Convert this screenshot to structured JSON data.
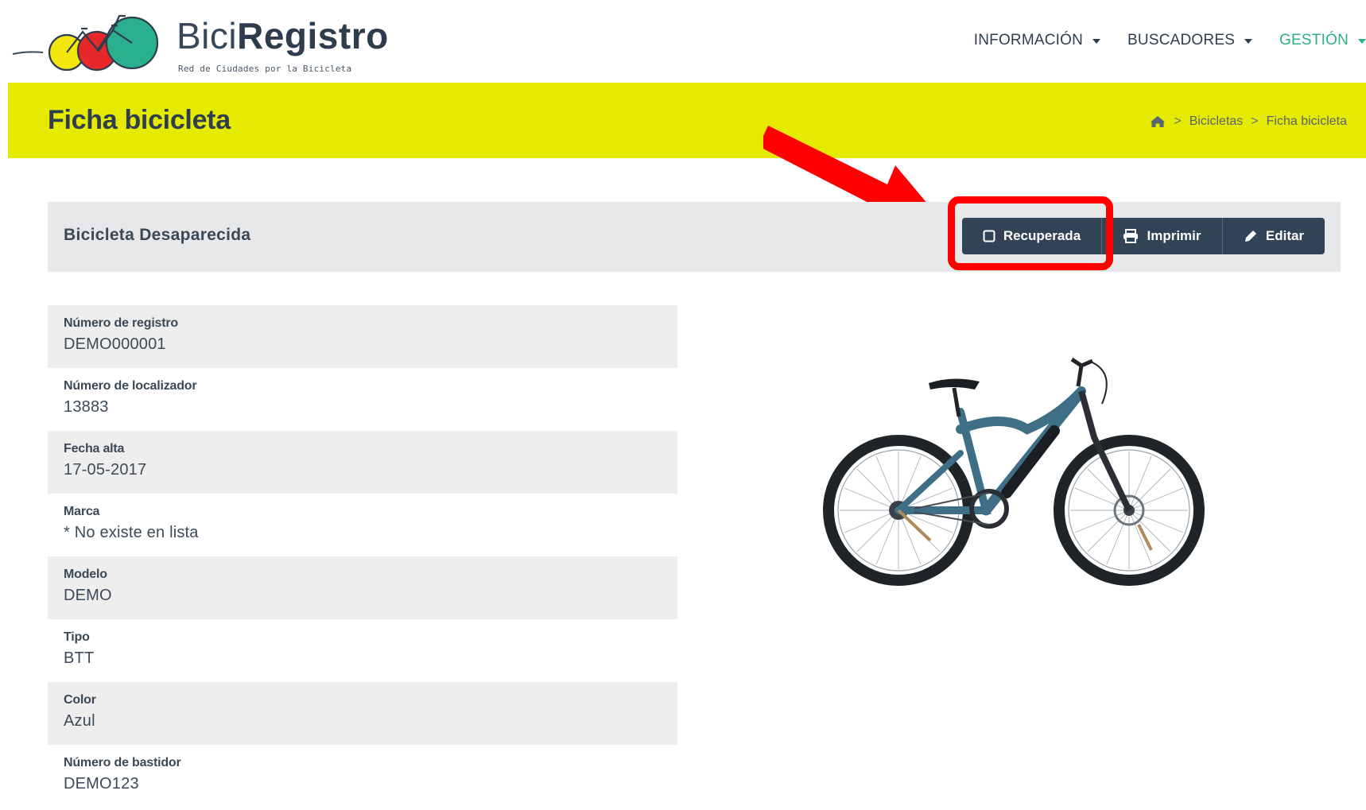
{
  "brand": {
    "name_light": "Bici",
    "name_bold": "Registro",
    "subtitle": "Red de Ciudades por la Bicicleta",
    "logo_colors": [
      "#f2e500",
      "#e8272a",
      "#2bb08f"
    ]
  },
  "nav": {
    "items": [
      {
        "label": "INFORMACIÓN",
        "active": false
      },
      {
        "label": "BUSCADORES",
        "active": false
      },
      {
        "label": "GESTIÓN",
        "active": true
      }
    ],
    "active_color": "#2bb088"
  },
  "title_bar": {
    "title": "Ficha bicicleta",
    "background": "#e6ea00",
    "breadcrumb": {
      "home_icon": "home-icon",
      "items": [
        "Bicicletas",
        "Ficha bicicleta"
      ]
    }
  },
  "panel": {
    "title": "Bicicleta Desaparecida",
    "buttons": [
      {
        "label": "Recuperada",
        "icon": "checkbox-icon"
      },
      {
        "label": "Imprimir",
        "icon": "print-icon"
      },
      {
        "label": "Editar",
        "icon": "pencil-icon"
      }
    ],
    "highlighted_button": "Recuperada",
    "button_color": "#334356"
  },
  "details": [
    {
      "label": "Número de registro",
      "value": "DEMO000001"
    },
    {
      "label": "Número de localizador",
      "value": "13883"
    },
    {
      "label": "Fecha alta",
      "value": "17-05-2017"
    },
    {
      "label": "Marca",
      "value": "* No existe en lista"
    },
    {
      "label": "Modelo",
      "value": "DEMO"
    },
    {
      "label": "Tipo",
      "value": "BTT"
    },
    {
      "label": "Color",
      "value": "Azul"
    },
    {
      "label": "Número de bastidor",
      "value": "DEMO123"
    }
  ],
  "annotation": {
    "highlight_color": "#ff0000"
  }
}
